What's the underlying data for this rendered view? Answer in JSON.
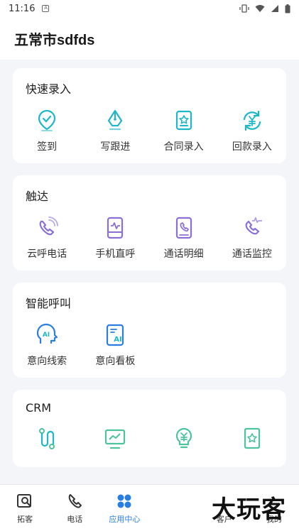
{
  "status": {
    "time": "11:16",
    "app_letter": "A"
  },
  "header": {
    "title": "五常市sdfds"
  },
  "colors": {
    "icon_teal": "#1cb7c8",
    "icon_purple": "#8b6fd6",
    "icon_green": "#4cc39a",
    "accent_blue": "#2a7de1"
  },
  "sections": [
    {
      "title": "快速录入",
      "items": [
        {
          "label": "签到",
          "icon": "checkin-location-icon"
        },
        {
          "label": "写跟进",
          "icon": "pen-nib-icon"
        },
        {
          "label": "合同录入",
          "icon": "contract-icon"
        },
        {
          "label": "回款录入",
          "icon": "payment-refresh-icon"
        }
      ]
    },
    {
      "title": "触达",
      "items": [
        {
          "label": "云呼电话",
          "icon": "cloud-call-icon"
        },
        {
          "label": "手机直呼",
          "icon": "mobile-call-icon"
        },
        {
          "label": "通话明细",
          "icon": "call-detail-icon"
        },
        {
          "label": "通话监控",
          "icon": "call-monitor-icon"
        }
      ]
    },
    {
      "title": "智能呼叫",
      "items": [
        {
          "label": "意向线索",
          "icon": "ai-lead-icon"
        },
        {
          "label": "意向看板",
          "icon": "ai-board-icon"
        }
      ]
    },
    {
      "title": "CRM",
      "items": [
        {
          "icon": "flow-icon"
        },
        {
          "icon": "chart-monitor-icon"
        },
        {
          "icon": "money-bulb-icon"
        },
        {
          "icon": "certificate-icon"
        }
      ]
    }
  ],
  "tabs": [
    {
      "label": "拓客",
      "icon": "search-customer-icon"
    },
    {
      "label": "电话",
      "icon": "phone-icon"
    },
    {
      "label": "应用中心",
      "icon": "app-center-icon",
      "active": true
    },
    {
      "label": "",
      "icon": ""
    },
    {
      "label": "客户",
      "icon": "customer-icon"
    },
    {
      "label": "我的",
      "icon": "profile-icon"
    }
  ],
  "watermark": "大玩客"
}
